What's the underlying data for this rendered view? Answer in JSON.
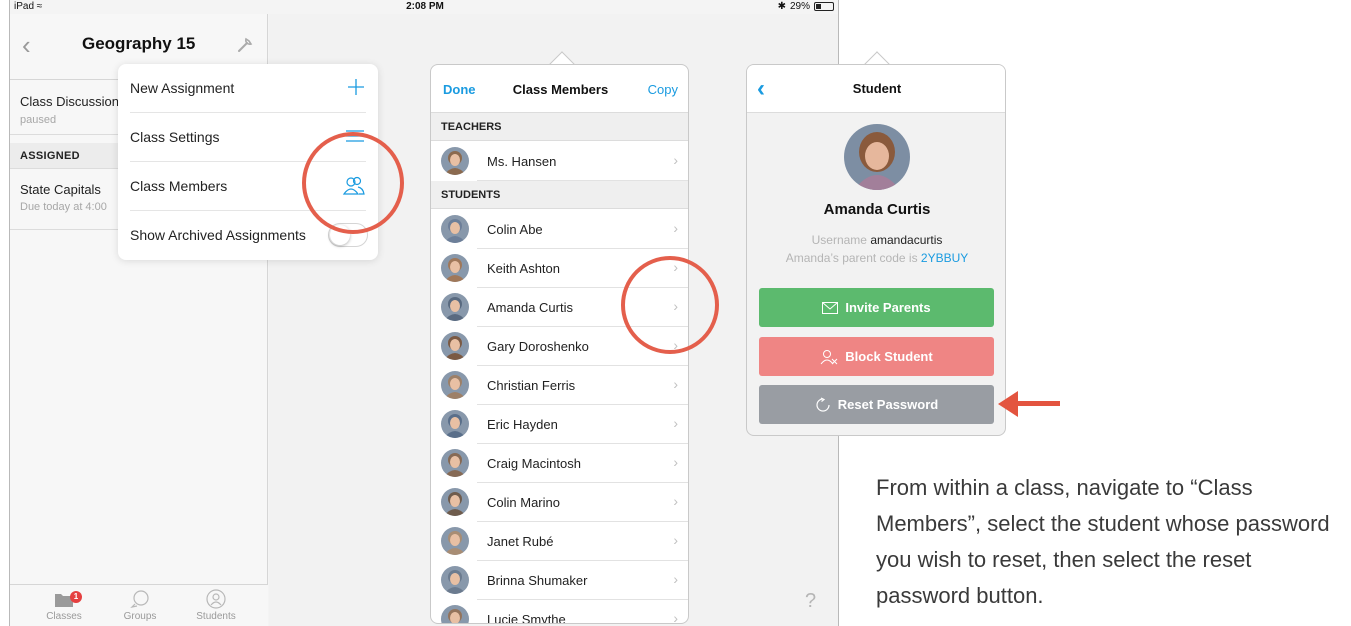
{
  "statusbar": {
    "device": "iPad",
    "time": "2:08 PM",
    "battery": "29%"
  },
  "left_nav": {
    "title": "Geography 15"
  },
  "left_list": {
    "rows": [
      {
        "title": "Class Discussion",
        "subtitle": "paused"
      }
    ],
    "section_label": "ASSIGNED",
    "assigned": [
      {
        "title": "State Capitals",
        "subtitle": "Due today at 4:00"
      }
    ]
  },
  "tabbar": {
    "tabs": [
      {
        "label": "Classes",
        "badge": "1"
      },
      {
        "label": "Groups"
      },
      {
        "label": "Students"
      }
    ]
  },
  "menu": {
    "items": [
      {
        "label": "New Assignment",
        "icon": "plus-icon"
      },
      {
        "label": "Class Settings",
        "icon": "list-icon"
      },
      {
        "label": "Class Members",
        "icon": "people-icon"
      },
      {
        "label": "Show Archived Assignments",
        "icon": "toggle-switch",
        "toggle_on": false
      }
    ]
  },
  "members": {
    "done_label": "Done",
    "title": "Class Members",
    "copy_label": "Copy",
    "teachers_label": "TEACHERS",
    "teachers": [
      "Ms. Hansen"
    ],
    "students_label": "STUDENTS",
    "students": [
      "Colin Abe",
      "Keith Ashton",
      "Amanda Curtis",
      "Gary Doroshenko",
      "Christian Ferris",
      "Eric Hayden",
      "Craig Macintosh",
      "Colin Marino",
      "Janet Rubé",
      "Brinna Shumaker",
      "Lucie Smythe"
    ]
  },
  "student": {
    "title": "Student",
    "name": "Amanda Curtis",
    "username_label": "Username",
    "username": "amandacurtis",
    "parent_code_label": "Amanda’s parent code is",
    "parent_code": "2YBBUY",
    "buttons": [
      {
        "label": "Invite Parents",
        "icon": "envelope-icon",
        "color": "#5cba6e"
      },
      {
        "label": "Block Student",
        "icon": "block-user-icon",
        "color": "#ef8584"
      },
      {
        "label": "Reset Password",
        "icon": "reset-icon",
        "color": "#999da3"
      }
    ]
  },
  "help": {
    "label": "?"
  },
  "caption": "From within a class, navigate to “Class Members”, select the student whose password you wish to reset, then select the reset password button.",
  "colors": {
    "accent": "#1a9be0",
    "annotation": "#e45f4c"
  }
}
